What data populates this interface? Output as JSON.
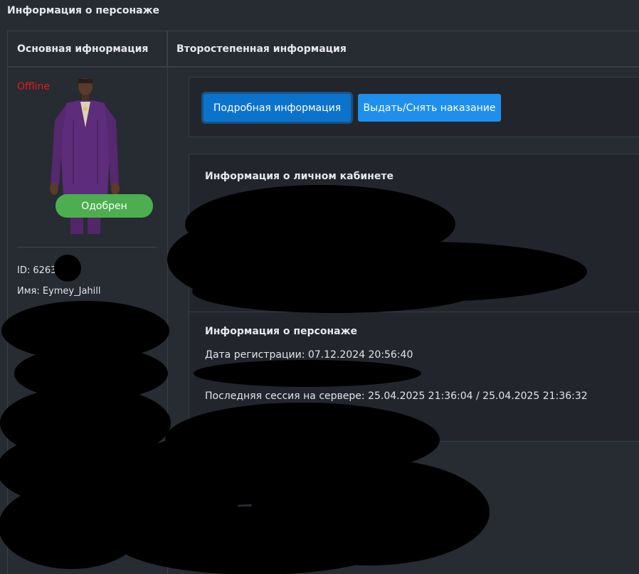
{
  "page": {
    "title": "Информация о персонаже"
  },
  "columns": {
    "left_header": "Основная ифнормация",
    "right_header": "Второстепенная информация"
  },
  "profile": {
    "status": "Offline",
    "status_color": "#e31b1b",
    "badge": "Одобрен",
    "id_text": "ID: 6263",
    "name_text": "Имя: Eymey_Jahill"
  },
  "actions": {
    "details_label": "Подробная информация",
    "punish_label": "Выдать/Снять наказание"
  },
  "cabinet": {
    "title": "Информация о личном кабинете"
  },
  "character": {
    "title": "Информация о персонаже",
    "registration": "Дата регистрации: 07.12.2024 20:56:40",
    "last_session": "Последняя сессия на сервере: 25.04.2025 21:36:04 / 25.04.2025 21:36:32"
  },
  "colors": {
    "background": "#272b32",
    "primary_button": "#0c73cc",
    "secondary_button": "#1e8fed",
    "approved": "#4cae4f"
  }
}
